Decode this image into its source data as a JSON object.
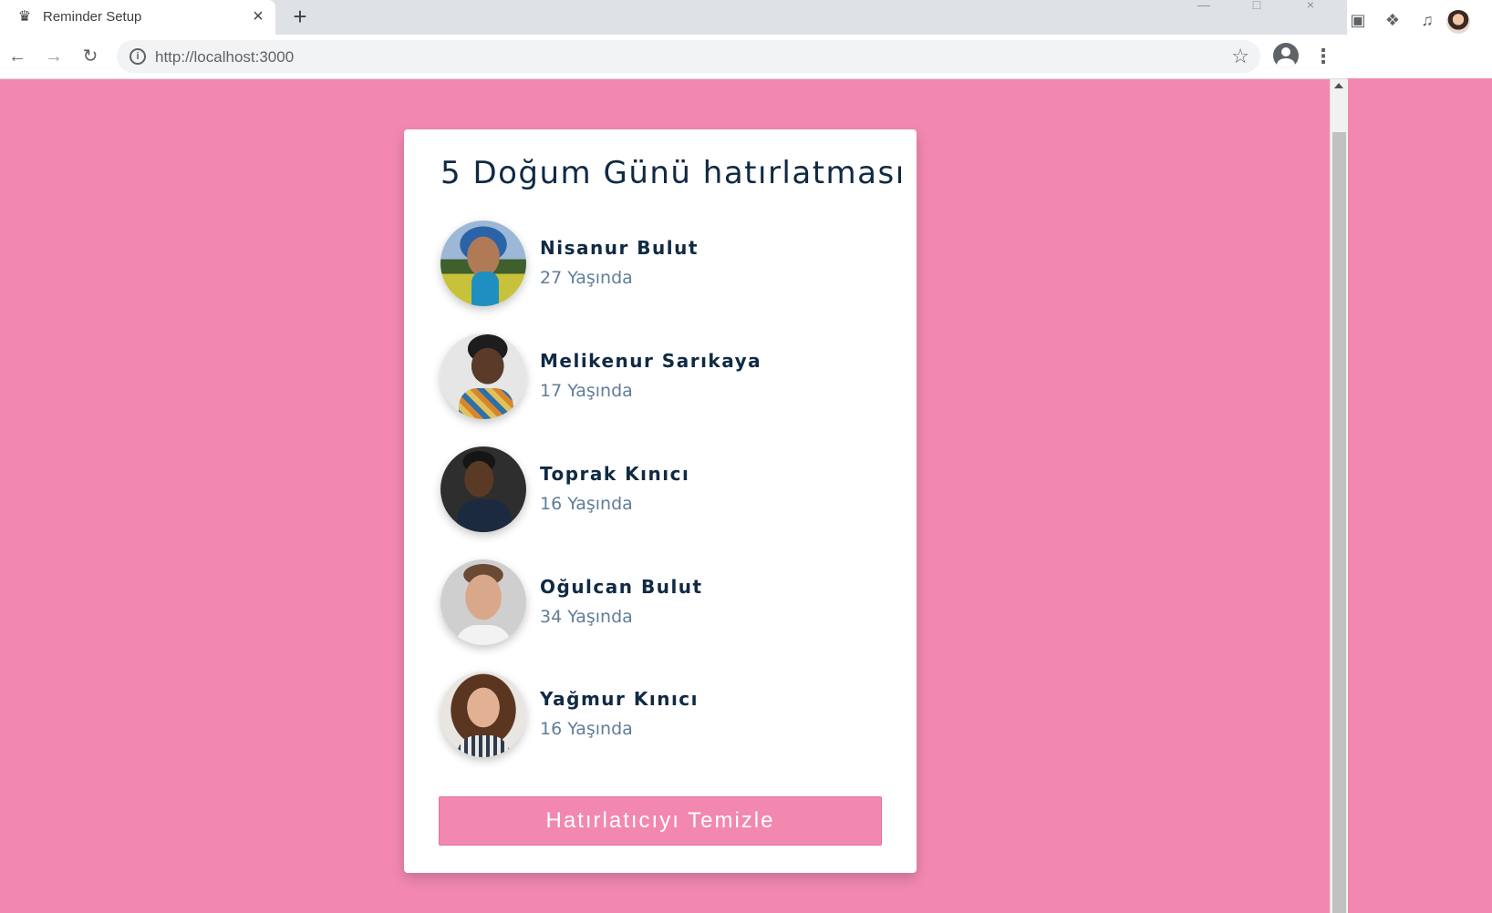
{
  "browser": {
    "tab_title": "Reminder Setup",
    "new_tab_label": "+",
    "url_host": "http://localhost",
    "url_port": ":3000"
  },
  "app": {
    "title": "5 Doğum Günü hatırlatması",
    "people": [
      {
        "name": "Nisanur Bulut",
        "age": "27 Yaşında"
      },
      {
        "name": "Melikenur Sarıkaya",
        "age": "17 Yaşında"
      },
      {
        "name": "Toprak Kınıcı",
        "age": "16 Yaşında"
      },
      {
        "name": "Oğulcan Bulut",
        "age": "34 Yaşında"
      },
      {
        "name": "Yağmur Kınıcı",
        "age": "16 Yaşında"
      }
    ],
    "clear_button_label": "Hatırlatıcıyı Temizle"
  },
  "colors": {
    "background": "#f288b0",
    "title_text": "#102a43",
    "age_text": "#617d98",
    "button": "#f288b0"
  },
  "icons": [
    "favicon-icon",
    "close-icon",
    "back-icon",
    "forward-icon",
    "reload-icon",
    "info-icon",
    "star-icon",
    "profile-icon",
    "menu-icon",
    "extension-icon",
    "puzzle-icon",
    "media-icon"
  ]
}
